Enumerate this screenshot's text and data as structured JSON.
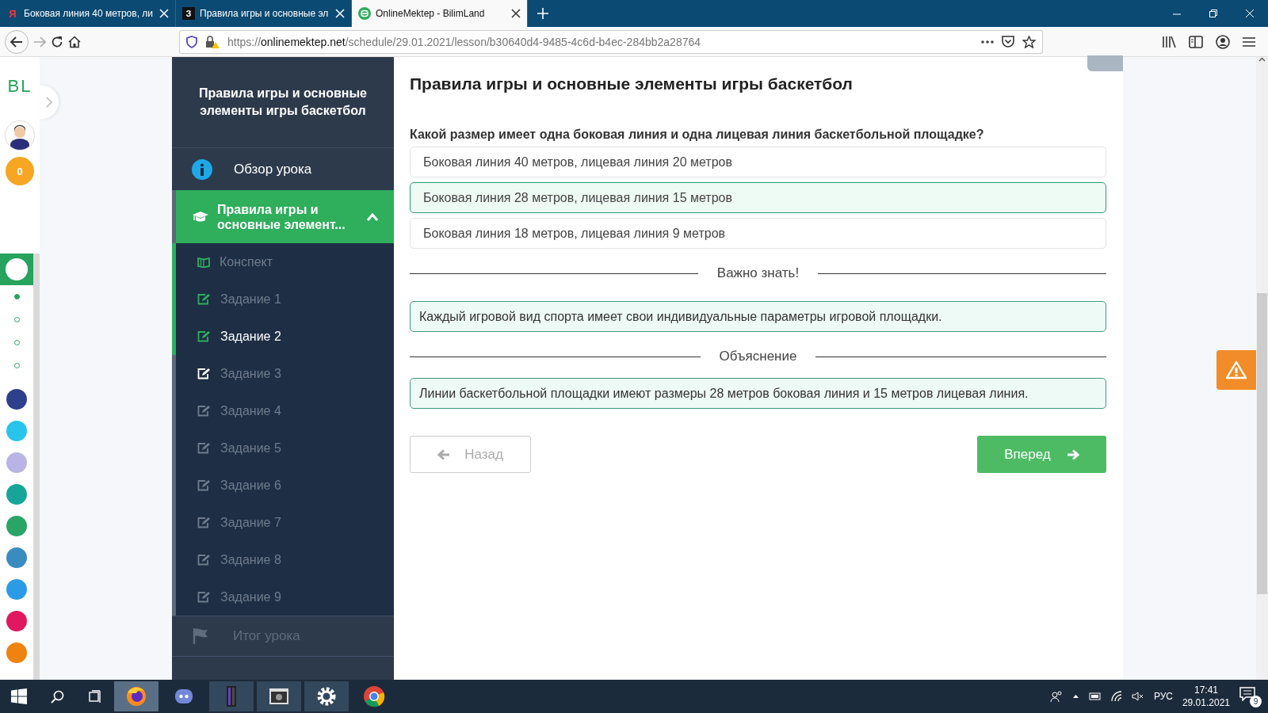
{
  "browser": {
    "tabs": [
      {
        "favicon": "Я",
        "kind": "letter-red",
        "title": "Боковая линия 40 метров, ли",
        "selected": false
      },
      {
        "favicon": "З",
        "kind": "letter-black",
        "title": "Правила игры и основные эл",
        "selected": false
      },
      {
        "kind": "round-green",
        "title": "OnlineMektep - BilimLand",
        "selected": true
      }
    ],
    "url": {
      "scheme": "https://",
      "host": "onlinemektep.net",
      "path": "/schedule/29.01.2021/lesson/b30640d4-9485-4c6d-b4ec-284bb2a28764"
    }
  },
  "rail": {
    "logo": "BL",
    "score": "0",
    "dots": [
      {
        "selected": true
      },
      {
        "selected": false
      },
      {
        "selected": false
      },
      {
        "selected": false
      }
    ],
    "apps": [
      {
        "color": "#2e3f8c"
      },
      {
        "color": "#29c4ec"
      },
      {
        "color": "#b9b4e6"
      },
      {
        "color": "#17a59a"
      },
      {
        "color": "#2aa565"
      },
      {
        "color": "#3a8cc0"
      },
      {
        "color": "#2c9be6"
      },
      {
        "color": "#e0185f"
      },
      {
        "color": "#f0820f"
      }
    ]
  },
  "lesson_nav": {
    "title": "Правила игры и основные элементы игры баскетбол",
    "overview": "Обзор урока",
    "section": {
      "title": "Правила игры и основные элемент...",
      "expanded": true
    },
    "items": [
      {
        "kind": "notes",
        "label": "Конспект",
        "done": true,
        "selected": false
      },
      {
        "kind": "task",
        "label": "Задание 1",
        "done": true,
        "selected": false
      },
      {
        "kind": "task",
        "label": "Задание 2",
        "done": true,
        "selected": true
      },
      {
        "kind": "task",
        "label": "Задание 3",
        "done": false,
        "visited": true,
        "selected": false
      },
      {
        "kind": "task",
        "label": "Задание 4",
        "done": false,
        "visited": false,
        "selected": false
      },
      {
        "kind": "task",
        "label": "Задание 5",
        "done": false,
        "visited": false,
        "selected": false
      },
      {
        "kind": "task",
        "label": "Задание 6",
        "done": false,
        "visited": false,
        "selected": false
      },
      {
        "kind": "task",
        "label": "Задание 7",
        "done": false,
        "visited": false,
        "selected": false
      },
      {
        "kind": "task",
        "label": "Задание 8",
        "done": false,
        "visited": false,
        "selected": false
      },
      {
        "kind": "task",
        "label": "Задание 9",
        "done": false,
        "visited": false,
        "selected": false
      }
    ],
    "summary": {
      "label": "Итог урока",
      "disabled": true
    }
  },
  "content": {
    "title": "Правила игры и основные элементы игры баскетбол",
    "question": "Какой размер имеет одна боковая линия и одна лицевая линия баскетбольной площадке?",
    "options": [
      {
        "text": "Боковая линия 40 метров, лицевая линия 20 метров",
        "selected": false
      },
      {
        "text": "Боковая линия 28 метров, лицевая линия 15 метров",
        "selected": true
      },
      {
        "text": "Боковая линия 18 метров, лицевая линия 9 метров",
        "selected": false
      }
    ],
    "notes": [
      {
        "heading": "Важно знать!",
        "text": "Каждый игровой вид спорта имеет свои индивидуальные параметры игровой площадки."
      },
      {
        "heading": "Объяснение",
        "text": "Линии баскетбольной площадки имеют размеры 28 метров боковая линия и 15 метров лицевая линия."
      }
    ],
    "back": {
      "label": "Назад",
      "disabled": true
    },
    "next": {
      "label": "Вперед",
      "disabled": false
    }
  },
  "taskbar": {
    "apps": [
      {
        "kind": "firefox",
        "selected": true
      },
      {
        "kind": "discord",
        "selected": false
      },
      {
        "kind": "tower",
        "selected": false
      },
      {
        "kind": "terminal",
        "selected": false
      },
      {
        "kind": "settings",
        "selected": false
      },
      {
        "kind": "chrome",
        "selected": false
      }
    ],
    "language": "РУС",
    "time": "17:41",
    "date": "29.01.2021",
    "notifications": "9"
  }
}
